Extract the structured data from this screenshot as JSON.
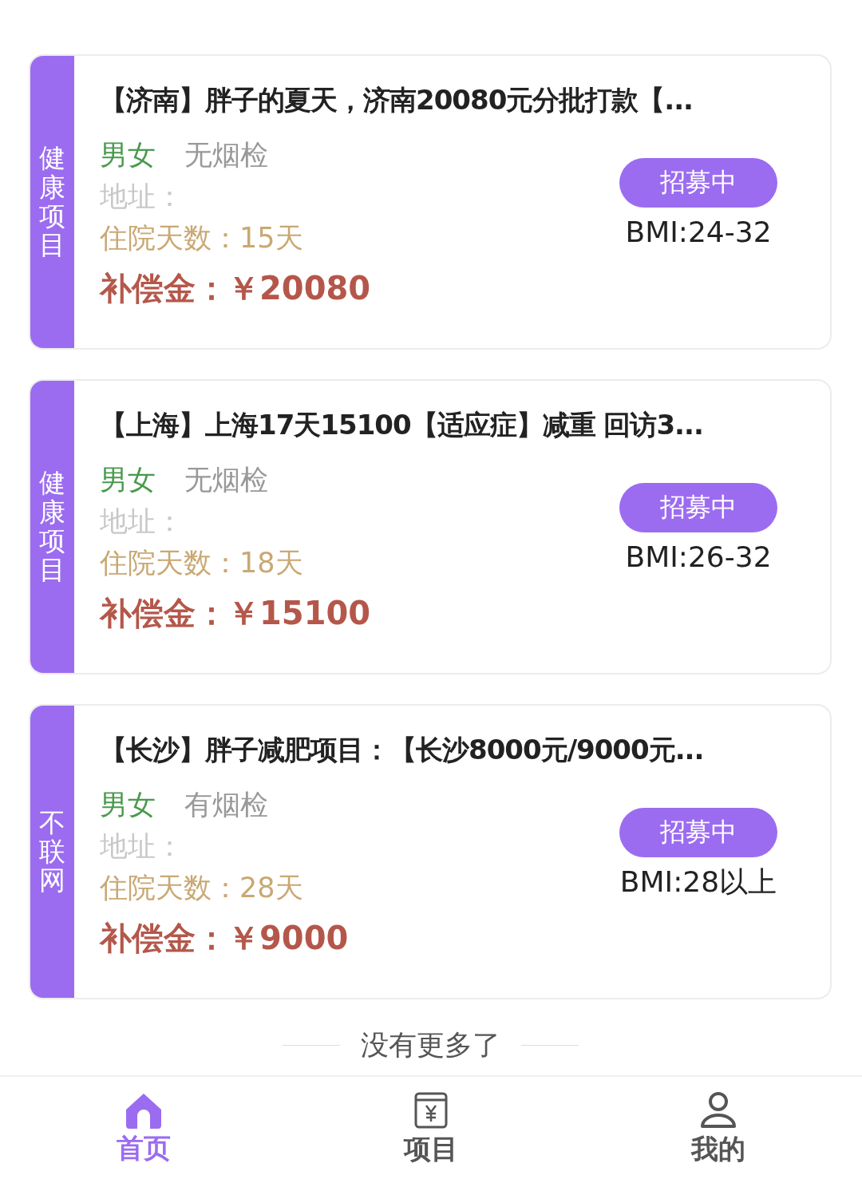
{
  "cards": [
    {
      "category": "健康项目",
      "title": "【济南】胖子的夏天，济南20080元分批打款【...",
      "gender": "男女",
      "smoke_check": "无烟检",
      "address": "地址：",
      "days": "住院天数：15天",
      "compensation": "补偿金：￥20080",
      "status": "招募中",
      "bmi": "BMI:24-32"
    },
    {
      "category": "健康项目",
      "title": "【上海】上海17天15100【适应症】减重 回访3...",
      "gender": "男女",
      "smoke_check": "无烟检",
      "address": "地址：",
      "days": "住院天数：18天",
      "compensation": "补偿金：￥15100",
      "status": "招募中",
      "bmi": "BMI:26-32"
    },
    {
      "category": "不联网",
      "title": "【长沙】胖子减肥项目：【长沙8000元/9000元...",
      "gender": "男女",
      "smoke_check": "有烟检",
      "address": "地址：",
      "days": "住院天数：28天",
      "compensation": "补偿金：￥9000",
      "status": "招募中",
      "bmi": "BMI:28以上"
    }
  ],
  "end_note": "没有更多了",
  "tabs": [
    {
      "kind": "home",
      "label": "首页",
      "selected": true
    },
    {
      "kind": "project",
      "label": "项目",
      "selected": false
    },
    {
      "kind": "profile",
      "label": "我的",
      "selected": false
    }
  ]
}
